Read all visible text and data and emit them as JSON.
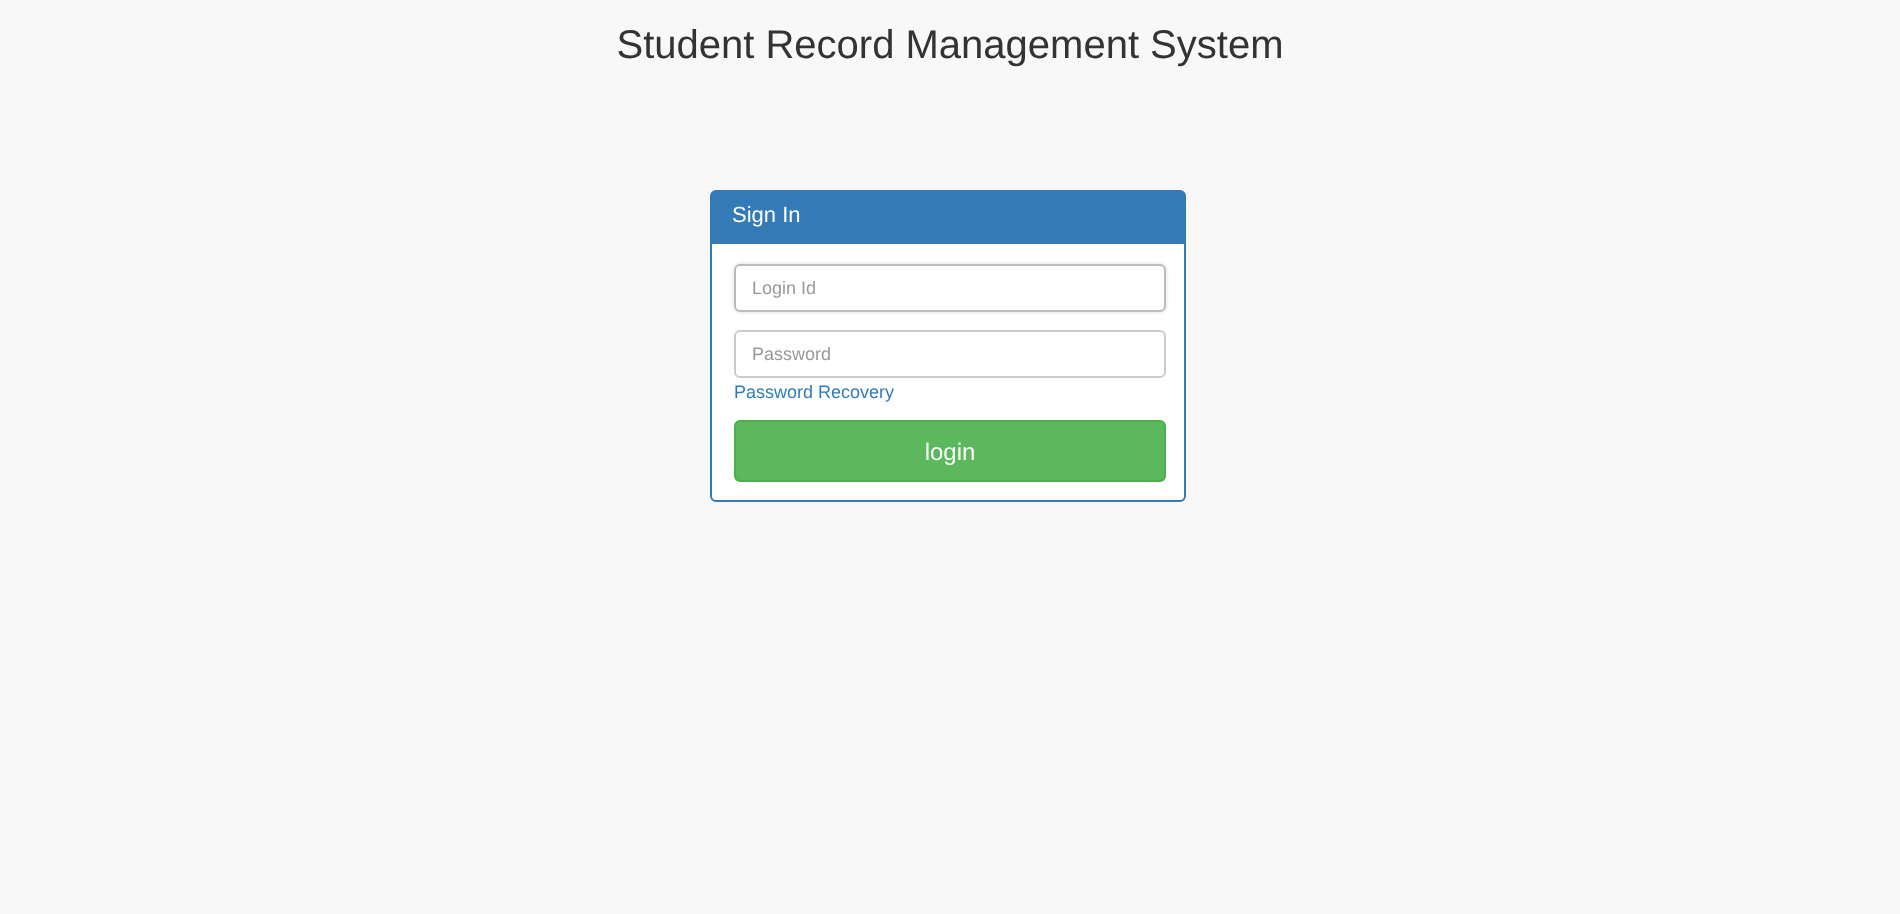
{
  "page_title": "Student Record Management System",
  "panel": {
    "title": "Sign In",
    "fields": [
      {
        "placeholder": "Login Id",
        "focused": true
      },
      {
        "placeholder": "Password",
        "focused": false
      }
    ],
    "link": "Password Recovery",
    "button": "login"
  }
}
